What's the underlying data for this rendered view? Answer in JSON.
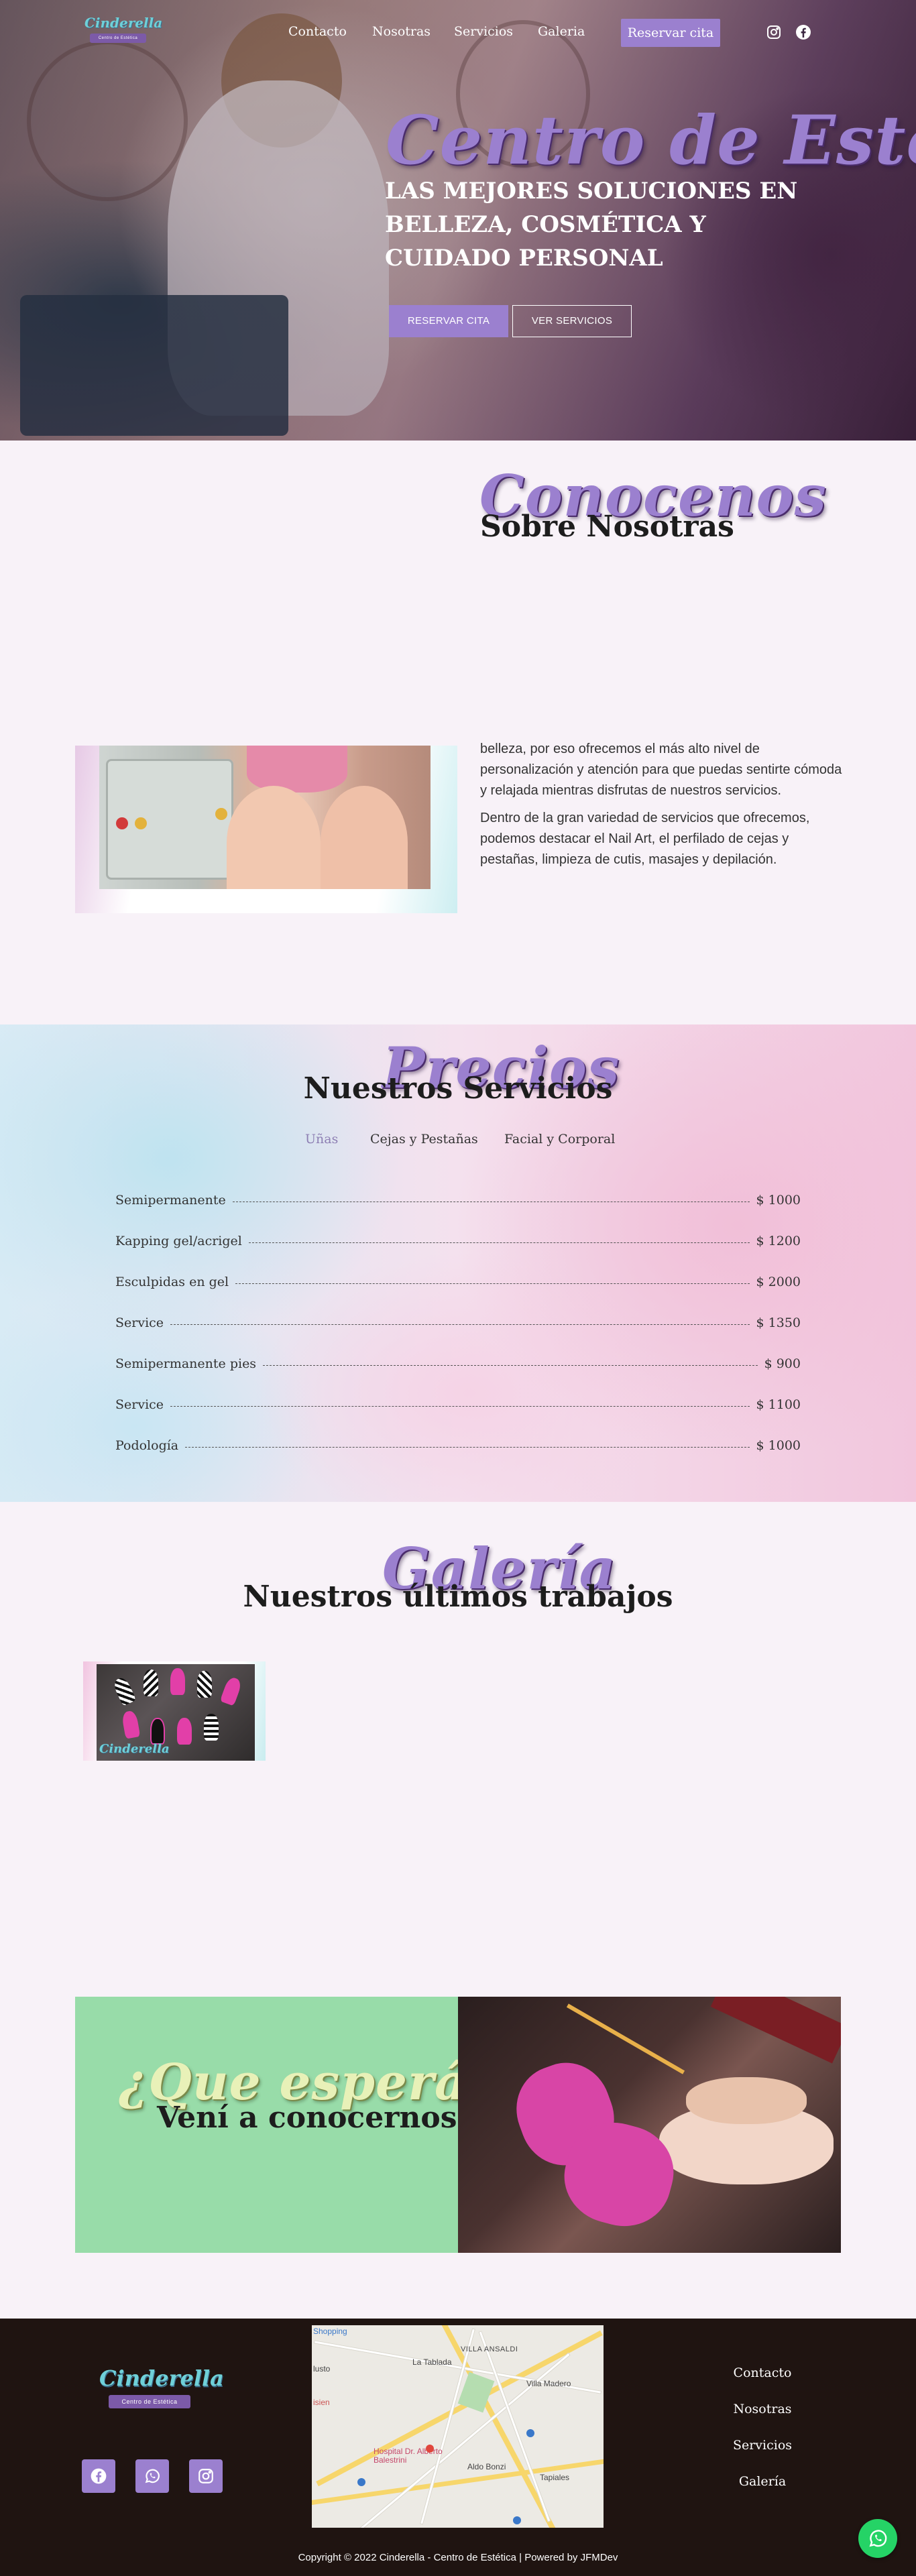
{
  "brand": {
    "name": "Cinderella",
    "tagline": "Centro de Estética"
  },
  "nav": {
    "items": [
      "Contacto",
      "Nosotras",
      "Servicios",
      "Galeria"
    ],
    "cta": "Reservar cita"
  },
  "hero": {
    "script_title": "Centro de Estética",
    "headline": "LAS MEJORES SOLUCIONES EN BELLEZA, COSMÉTICA Y CUIDADO PERSONAL",
    "primary_button": "RESERVAR CITA",
    "secondary_button": "VER SERVICIOS"
  },
  "about": {
    "script_title": "Conocenos",
    "title": "Sobre Nosotras",
    "paragraphs": [
      "belleza, por eso ofrecemos el más alto nivel de personalización y atención para que puedas sentirte cómoda y relajada mientras disfrutas de nuestros servicios.",
      "Dentro de la gran variedad de servicios que ofrecemos, podemos destacar el Nail Art, el perfilado de cejas y pestañas, limpieza de cutis, masajes y depilación."
    ]
  },
  "services": {
    "script_title": "Precios",
    "title": "Nuestros Servicios",
    "tabs": [
      "Uñas",
      "Cejas y Pestañas",
      "Facial y Corporal"
    ],
    "active_tab": "Uñas",
    "items": [
      {
        "name": "Semipermanente",
        "price": "$ 1000"
      },
      {
        "name": "Kapping gel/acrigel",
        "price": "$ 1200"
      },
      {
        "name": "Esculpidas en gel",
        "price": "$ 2000"
      },
      {
        "name": "Service",
        "price": "$ 1350"
      },
      {
        "name": "Semipermanente pies",
        "price": "$ 900"
      },
      {
        "name": "Service",
        "price": "$ 1100"
      },
      {
        "name": "Podología",
        "price": "$ 1000"
      }
    ]
  },
  "gallery": {
    "script_title": "Galería",
    "title": "Nuestros últimos trabajos",
    "watermark": "Cinderella"
  },
  "cta": {
    "script_title": "¿Que esperás?",
    "title": "Vení a conocernos"
  },
  "footer": {
    "links": [
      "Contacto",
      "Nosotras",
      "Servicios",
      "Galería"
    ],
    "copyright": "Copyright © 2022 Cinderella - Centro de Estética | Powered by JFMDev",
    "map_labels": {
      "shopping": "Shopping",
      "villa_ansaldi": "VILLA ANSALDI",
      "la_tablada": "La Tablada",
      "justo": "lusto",
      "villa_madero": "Villa Madero",
      "hospital": "Hospital Dr. Alberto Balestrini",
      "aldo_bonzi": "Aldo Bonzi",
      "tapiales": "Tapiales",
      "misien": "isien",
      "ruta": "ruta"
    }
  },
  "colors": {
    "accent": "#9b80cf",
    "cta_green": "#98dca9",
    "footer_bg": "#1f1411",
    "whatsapp": "#25d366"
  }
}
